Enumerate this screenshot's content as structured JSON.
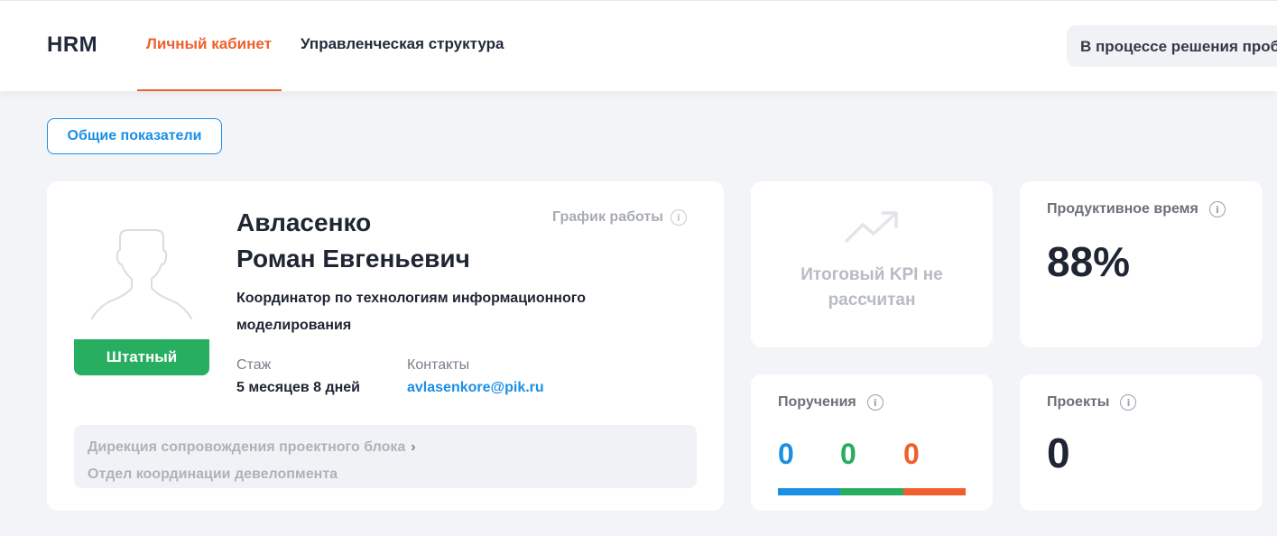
{
  "header": {
    "logo": "HRM",
    "tabs": [
      {
        "label": "Личный кабинет",
        "active": true
      },
      {
        "label": "Управленческая структура",
        "active": false
      }
    ],
    "status": "В процессе решения проблемы"
  },
  "overview_button": "Общие показатели",
  "profile": {
    "last_name": "Авласенко",
    "first_middle_name": "Роман Евгеньевич",
    "badge": "Штатный",
    "schedule_label": "График работы",
    "position": "Координатор по технологиям информационного моделирования",
    "tenure_label": "Стаж",
    "tenure_value": "5 месяцев 8 дней",
    "contacts_label": "Контакты",
    "contacts_value": "avlasenkore@pik.ru",
    "department": "Дирекция сопровождения проектного блока",
    "division": "Отдел координации девелопмента"
  },
  "kpi": {
    "text": "Итоговый KPI не рассчитан"
  },
  "productive_time": {
    "title": "Продуктивное время",
    "value": "88%"
  },
  "tasks": {
    "title": "Поручения",
    "counts": [
      {
        "value": "0",
        "color": "#1a8fe6"
      },
      {
        "value": "0",
        "color": "#27ae60"
      },
      {
        "value": "0",
        "color": "#f0602c"
      }
    ]
  },
  "projects": {
    "title": "Проекты",
    "value": "0"
  },
  "colors": {
    "accent": "#f0602c",
    "link": "#1a8fe6",
    "success": "#27ae60",
    "background": "#f3f4f8"
  }
}
